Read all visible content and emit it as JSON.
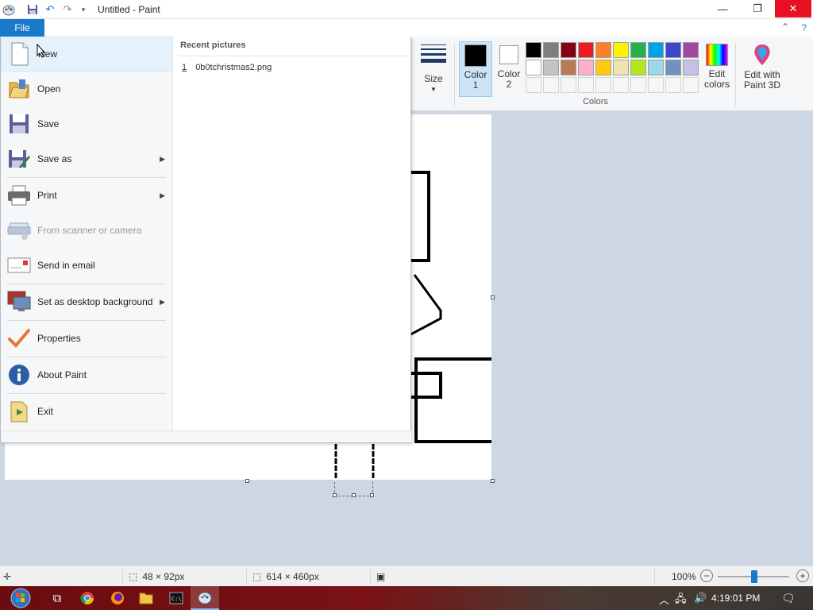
{
  "window": {
    "title": "Untitled - Paint",
    "minimize_glyph": "—",
    "maximize_glyph": "❐",
    "close_glyph": "✕"
  },
  "ribbon": {
    "file_tab": "File",
    "help_glyph": "?",
    "collapse_glyph": "⌃",
    "size_label": "Size",
    "color1_label_1": "Color",
    "color1_label_2": "1",
    "color2_label_1": "Color",
    "color2_label_2": "2",
    "edit_colors_1": "Edit",
    "edit_colors_2": "colors",
    "paint3d_1": "Edit with",
    "paint3d_2": "Paint 3D",
    "colors_group": "Colors",
    "color1_value": "#000000",
    "color2_value": "#ffffff",
    "palette": [
      "#000000",
      "#7f7f7f",
      "#880015",
      "#ed1c24",
      "#ff7f27",
      "#fff200",
      "#22b14c",
      "#00a2e8",
      "#3f48cc",
      "#a349a4",
      "#ffffff",
      "#c3c3c3",
      "#b97a57",
      "#ffaec9",
      "#ffc90e",
      "#efe4b0",
      "#b5e61d",
      "#99d9ea",
      "#7092be",
      "#c8bfe7"
    ]
  },
  "file_menu": {
    "items": [
      {
        "label": "New",
        "icon": "new-document-icon"
      },
      {
        "label": "Open",
        "icon": "open-folder-icon"
      },
      {
        "label": "Save",
        "icon": "save-disk-icon"
      },
      {
        "label": "Save as",
        "icon": "save-as-icon"
      },
      {
        "label": "Print",
        "icon": "printer-icon"
      },
      {
        "label": "From scanner or camera",
        "icon": "scanner-icon"
      },
      {
        "label": "Send in email",
        "icon": "email-icon"
      },
      {
        "label": "Set as desktop background",
        "icon": "desktop-background-icon"
      },
      {
        "label": "Properties",
        "icon": "checkmark-icon"
      },
      {
        "label": "About Paint",
        "icon": "info-icon"
      },
      {
        "label": "Exit",
        "icon": "exit-icon"
      }
    ],
    "recent_title": "Recent pictures",
    "recent": [
      {
        "num": "1",
        "name": "0b0tchristmas2.png"
      }
    ]
  },
  "status": {
    "selection_size": "48 × 92px",
    "image_size": "614 × 460px",
    "zoom": "100%",
    "zoom_minus": "−",
    "zoom_plus": "+"
  },
  "taskbar": {
    "time": "4:19:01 PM"
  }
}
